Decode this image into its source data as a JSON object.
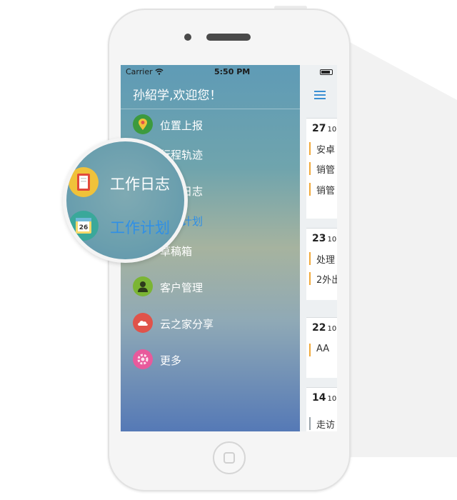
{
  "status_bar": {
    "carrier": "Carrier",
    "time": "5:50 PM"
  },
  "header": {
    "welcome": "孙紹学,欢迎您！"
  },
  "menu": {
    "items": [
      {
        "label": "位置上报",
        "icon": "location-pin-icon",
        "color": "#3c9a3e"
      },
      {
        "label": "行程轨迹",
        "icon": "route-icon",
        "color": "#e8a23a"
      },
      {
        "label": "工作日志",
        "icon": "journal-icon",
        "color": "#f0c23a"
      },
      {
        "label": "工作计划",
        "icon": "calendar-icon",
        "color": "#3aa89a"
      },
      {
        "label": "草稿箱",
        "icon": "drafts-icon",
        "color": "#5b8fd0"
      },
      {
        "label": "客户管理",
        "icon": "person-icon",
        "color": "#7bb534"
      },
      {
        "label": "云之家分享",
        "icon": "cloud-icon",
        "color": "#e0534a"
      },
      {
        "label": "更多",
        "icon": "gear-icon",
        "color": "#e85a9c"
      }
    ]
  },
  "magnifier": {
    "items": [
      {
        "label": "工作日志",
        "icon": "journal-icon",
        "text_color": "#ffffff"
      },
      {
        "label": "工作计划",
        "icon": "calendar-icon",
        "text_color": "#2f8fe6"
      }
    ],
    "calendar_number": "26"
  },
  "list": {
    "cards": [
      {
        "day": "27",
        "month": "10",
        "lines": [
          "安卓",
          "销管",
          "销管"
        ]
      },
      {
        "day": "23",
        "month": "10",
        "lines": [
          "处理",
          "2外出"
        ]
      },
      {
        "day": "22",
        "month": "10",
        "lines": [
          "AA"
        ]
      },
      {
        "day": "14",
        "month": "10",
        "lines": [
          "走访"
        ]
      }
    ]
  }
}
